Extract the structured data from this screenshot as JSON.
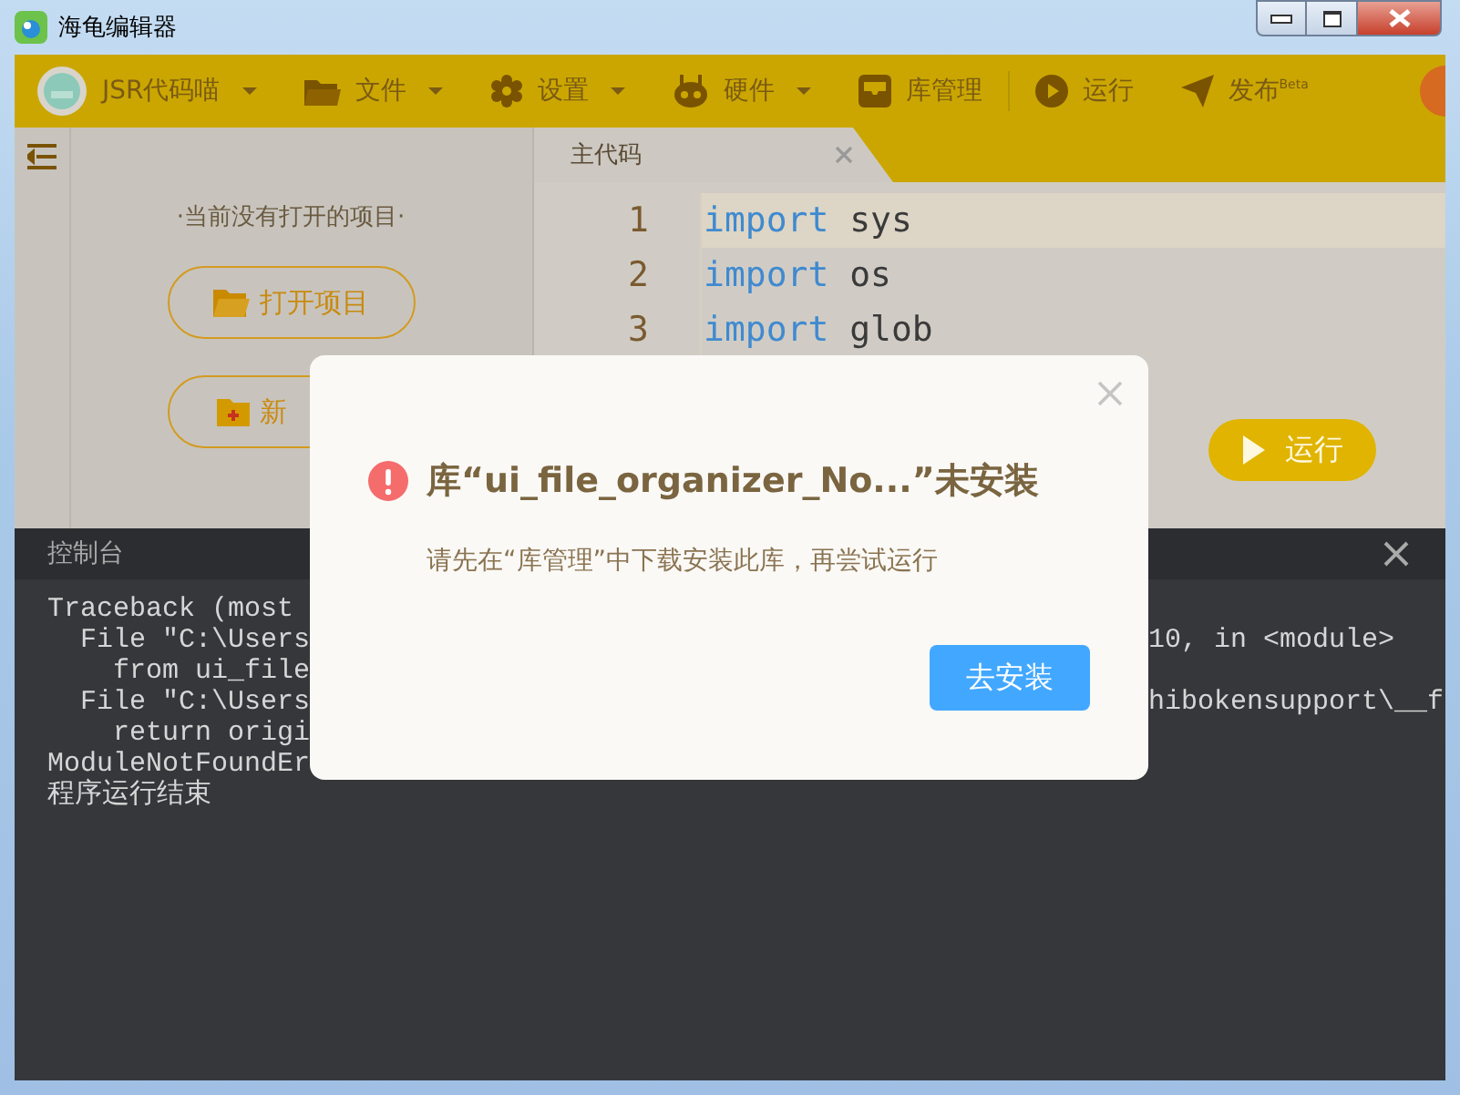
{
  "window": {
    "title": "海龟编辑器"
  },
  "toolbar": {
    "items": [
      {
        "label": "JSR代码喵",
        "kind": "account",
        "dropdown": true
      },
      {
        "label": "文件",
        "kind": "folder",
        "dropdown": true
      },
      {
        "label": "设置",
        "kind": "gear",
        "dropdown": true
      },
      {
        "label": "硬件",
        "kind": "hardware",
        "dropdown": true
      },
      {
        "label": "库管理",
        "kind": "library",
        "dropdown": false
      },
      {
        "label": "运行",
        "kind": "run",
        "dropdown": false
      },
      {
        "label": "发布$^{Beta}$",
        "kind": "publish",
        "dropdown": false
      }
    ]
  },
  "project_panel": {
    "message": "·当前没有打开的项目·",
    "buttons": [
      {
        "label": "打开项目",
        "kind": "open"
      },
      {
        "label": "新",
        "kind": "new"
      }
    ]
  },
  "editor": {
    "tabs": [
      {
        "label": "主代码",
        "selected": true
      }
    ],
    "lines": [
      {
        "number": "1",
        "keyword": "import",
        "name": "sys",
        "current": true
      },
      {
        "number": "2",
        "keyword": "import",
        "name": "os",
        "current": false
      },
      {
        "number": "3",
        "keyword": "import",
        "name": "glob",
        "current": false
      }
    ],
    "run_button": "运行"
  },
  "console": {
    "title": "控制台",
    "lines": [
      {
        "left": "Traceback (most"
      },
      {
        "left": "  File \"C:\\Users",
        "right": "10, in <module>"
      },
      {
        "left": "    from ui_file"
      },
      {
        "left": "  File \"C:\\Users",
        "right": "hibokensupport\\__f"
      },
      {
        "left": "    return origi"
      },
      {
        "left": "ModuleNotFoundEr"
      },
      {
        "left": "程序运行结束"
      }
    ]
  },
  "dialog": {
    "title": "库“ui_file_organizer_No...”未安装",
    "message": "请先在“库管理”中下载安装此库，再尝试运行",
    "button": "去安装"
  }
}
